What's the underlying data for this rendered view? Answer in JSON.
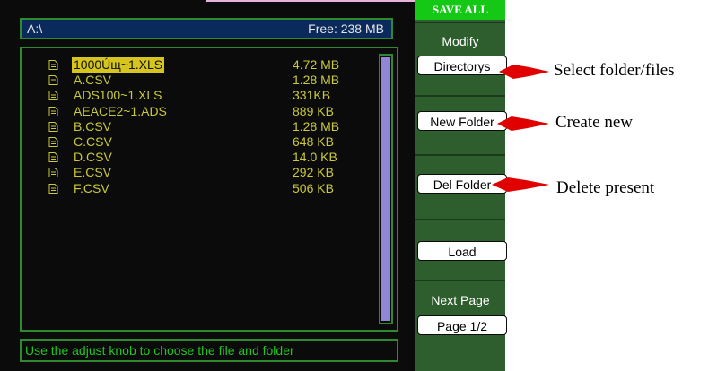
{
  "path_bar": {
    "path": "A:\\",
    "free": "Free: 238 MB"
  },
  "files": [
    {
      "name": "1000Úщ~1.XLS",
      "size": "4.72 MB",
      "selected": true
    },
    {
      "name": "A.CSV",
      "size": "1.28 MB"
    },
    {
      "name": "ADS100~1.XLS",
      "size": "331KB"
    },
    {
      "name": "AEACE2~1.ADS",
      "size": "889 KB"
    },
    {
      "name": "B.CSV",
      "size": "1.28 MB"
    },
    {
      "name": "C.CSV",
      "size": "648 KB"
    },
    {
      "name": "D.CSV",
      "size": "14.0 KB"
    },
    {
      "name": "E.CSV",
      "size": "292 KB"
    },
    {
      "name": "F.CSV",
      "size": "506 KB"
    }
  ],
  "file_icon": "document-icon",
  "hint": "Use the adjust knob to choose the file and folder",
  "menu": {
    "header": "SAVE ALL",
    "modify_title": "Modify",
    "directorys_button": "Directorys",
    "new_folder_button": "New Folder",
    "del_folder_button": "Del Folder",
    "load_button": "Load",
    "next_page_title": "Next Page",
    "page_button": "Page 1/2"
  },
  "annotations": {
    "select": "Select folder/files",
    "create": "Create new",
    "delete": "Delete present"
  },
  "colors": {
    "screen_bg": "#0b0b0b",
    "panel_border": "#2f8a2f",
    "file_text": "#c9c93a",
    "selected_bg": "#d6c51e",
    "menu_bg": "#2e5e2e",
    "menu_header_bg": "#16c816",
    "hint_text": "#20c520",
    "scroll_thumb": "#8f86d6",
    "arrow_red": "#e00000"
  }
}
